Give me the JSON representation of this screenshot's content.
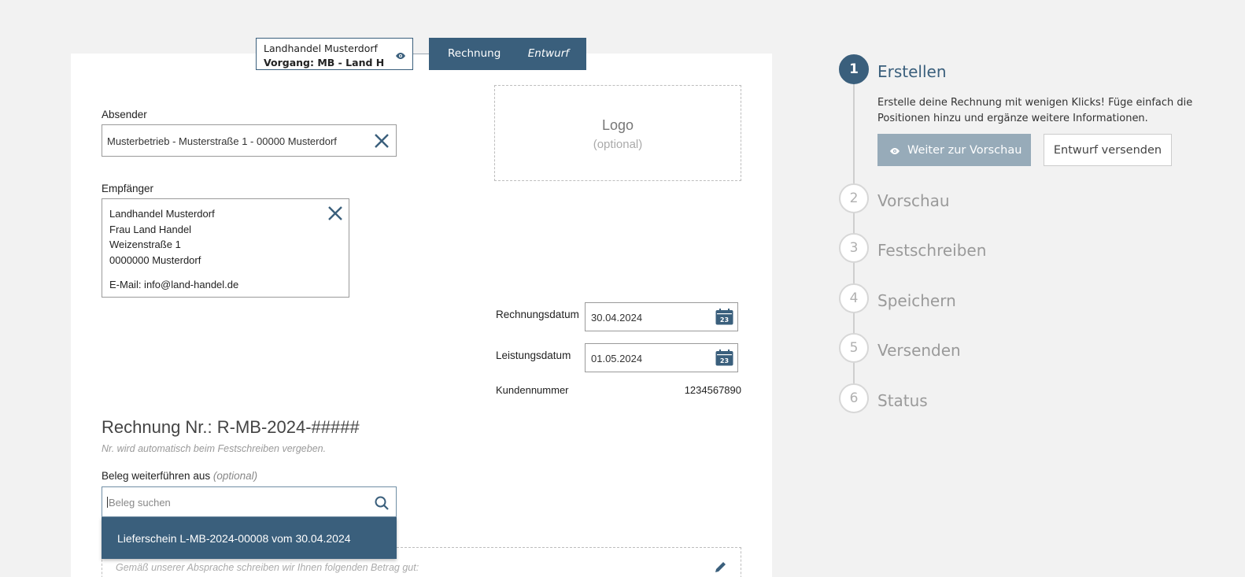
{
  "header": {
    "customer_name": "Landhandel Musterdorf",
    "process": "Vorgang: MB - Land H",
    "doc_type": "Rechnung",
    "doc_status": "Entwurf"
  },
  "sender": {
    "label": "Absender",
    "value": "Musterbetrieb - Musterstraße 1 - 00000 Musterdorf"
  },
  "logo": {
    "title": "Logo",
    "subtitle": "(optional)"
  },
  "recipient": {
    "label": "Empfänger",
    "lines": [
      "Landhandel Musterdorf",
      "Frau Land Handel",
      "Weizenstraße 1",
      "0000000 Musterdorf"
    ],
    "email": "E-Mail: info@land-handel.de"
  },
  "dates": {
    "invoice_date_label": "Rechnungsdatum",
    "invoice_date": "30.04.2024",
    "service_date_label": "Leistungsdatum",
    "service_date": "01.05.2024",
    "calendar_day": "23",
    "customer_number_label": "Kundennummer",
    "customer_number": "1234567890"
  },
  "invoice": {
    "title": "Rechnung Nr.: R-MB-2024-#####",
    "note": "Nr. wird automatisch beim Festschreiben vergeben.",
    "continue_label": "Beleg weiterführen aus",
    "continue_optional": "(optional)",
    "search_placeholder": "Beleg suchen",
    "dropdown_option": "Lieferschein L-MB-2024-00008 vom 30.04.2024",
    "text_placeholder": "Gemäß unserer Absprache schreiben wir Ihnen folgenden Betrag gut:"
  },
  "steps": [
    {
      "num": "1",
      "label": "Erstellen"
    },
    {
      "num": "2",
      "label": "Vorschau"
    },
    {
      "num": "3",
      "label": "Festschreiben"
    },
    {
      "num": "4",
      "label": "Speichern"
    },
    {
      "num": "5",
      "label": "Versenden"
    },
    {
      "num": "6",
      "label": "Status"
    }
  ],
  "step_active": {
    "description": "Erstelle deine Rechnung mit wenigen Klicks! Füge einfach die Positionen hinzu und ergänze weitere Informationen.",
    "preview_button": "Weiter zur Vorschau",
    "send_draft_button": "Entwurf versenden"
  },
  "colors": {
    "accent": "#3a5f7c",
    "accent_disabled": "#97abb9",
    "background": "#f2f2f2"
  }
}
